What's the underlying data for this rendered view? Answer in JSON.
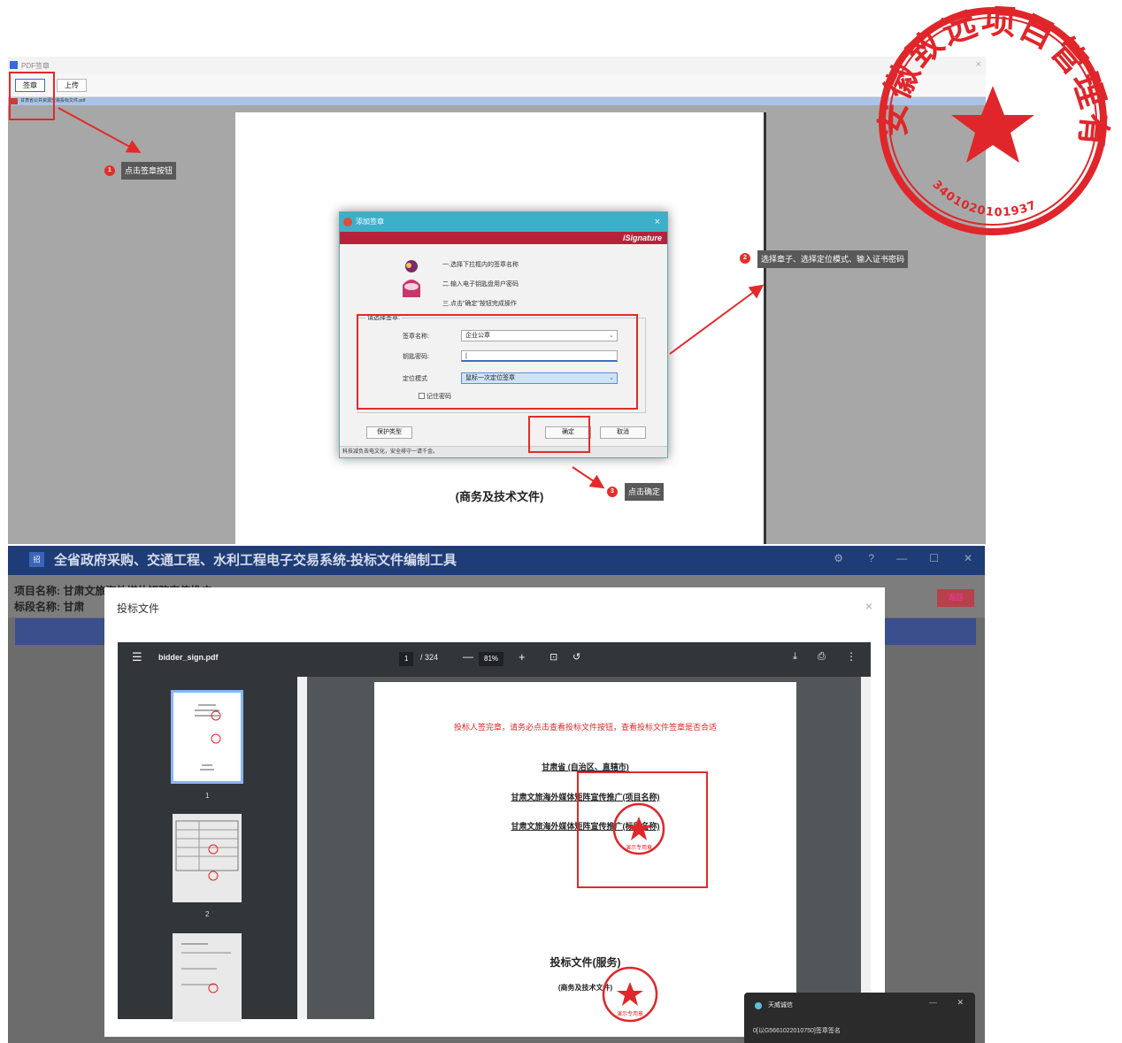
{
  "top_window": {
    "title": "PDF签章",
    "toolbar": {
      "sign_label": "签章",
      "upload_label": "上传"
    },
    "address_text": "甘肃省公共资源交易投标文件.pdf",
    "pdf_subtitle": "(商务及技术文件)"
  },
  "sign_dialog": {
    "title": "添加签章",
    "banner": "iSignature",
    "steps": [
      "一.选择下拉框内的签章名称",
      "二.输入电子钥匙盘用户密码",
      "三.点击\"确定\"按钮完成操作"
    ],
    "group_label": "请选择签章:",
    "fields": {
      "seal_name_label": "签章名称:",
      "seal_name_value": "企业公章",
      "password_label": "钥匙密码:",
      "password_value": "",
      "mode_label": "定位模式",
      "mode_value": "鼠标一次定位签章"
    },
    "remember_label": "记住密码",
    "protect_label": "保护类型",
    "ok_label": "确定",
    "cancel_label": "取消",
    "status_text": "科技减负去电文化，安全排守一请千金。"
  },
  "callouts": {
    "step1_num": "1",
    "step1_text": "点击签章按钮",
    "step2_num": "2",
    "step2_text": "选择章子、选择定位模式、输入证书密码",
    "step3_num": "3",
    "step3_text": "点击确定"
  },
  "big_seal": {
    "company_text": "安徽致远项目管理有限公司",
    "serial_text": "3401020101937"
  },
  "bottom_app": {
    "title": "全省政府采购、交通工程、水利工程电子交易系统-投标文件编制工具",
    "project_name_label": "项目名称: 甘肃",
    "project_name_rest": "文旅海外媒体矩阵宣传推广",
    "section_name_label": "标段名称: 甘肃",
    "right_button_label": "返回",
    "modal_title": "投标文件",
    "viewer": {
      "filename": "bidder_sign.pdf",
      "page_current": "1",
      "page_total": "/ 324",
      "zoom_value": "81%",
      "thumb_labels": [
        "1",
        "2"
      ]
    },
    "pdf_content": {
      "notice": "投标人签完章，请务必点击查看投标文件按钮，查看投标文件签章是否合适",
      "province_line": "甘肃省 (自治区、直辖市)",
      "project_line": "甘肃文旅海外媒体矩阵宣传推广(项目名称)",
      "section_line": "甘肃文旅海外媒体矩阵宣传推广(标段名称)",
      "bid_title": "投标文件(服务)",
      "bid_subtitle": "(商务及技术文件)",
      "small_seal_text": "演示专用章"
    },
    "notification": {
      "title": "天威诚信",
      "text": "0[以G5661022010750]签章签名"
    }
  },
  "colors": {
    "accent_red": "#e32a2a",
    "seal_red": "#e0262a",
    "dialog_title": "#3bb0c9",
    "dialog_banner": "#b7223a",
    "app_titlebar": "#1e3c77"
  }
}
